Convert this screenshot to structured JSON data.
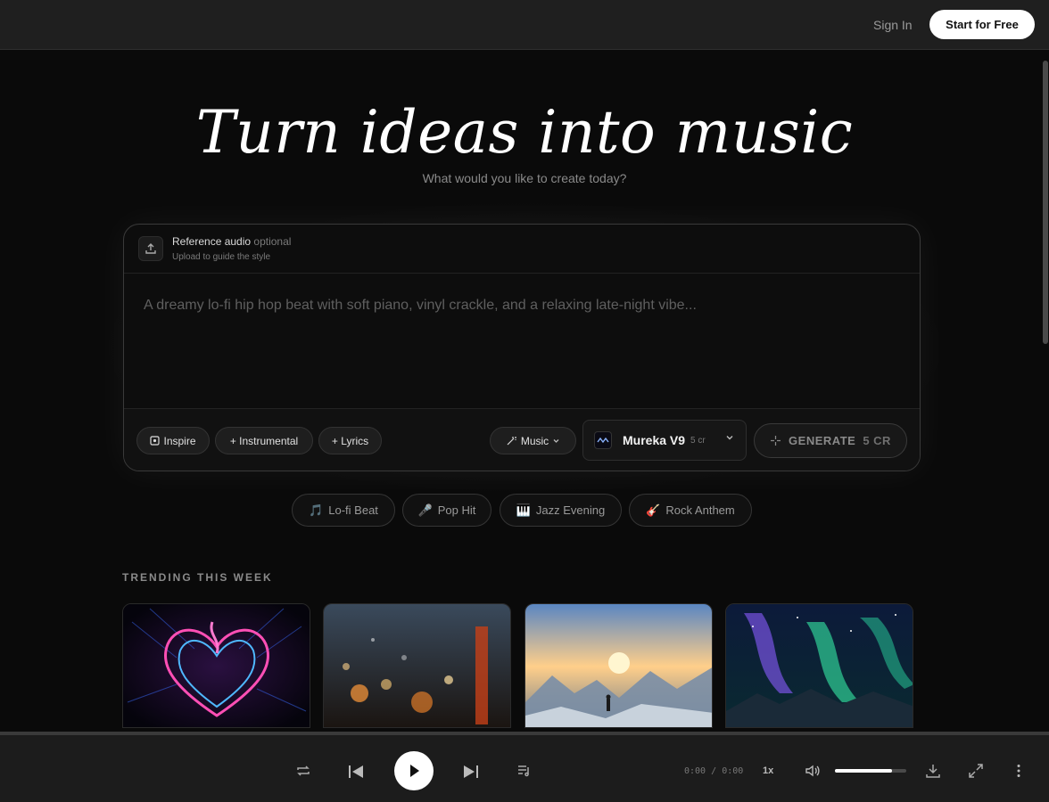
{
  "header": {
    "sign_in": "Sign In",
    "start_free": "Start for Free"
  },
  "hero": {
    "title": "Turn ideas into music",
    "subtitle": "What would you like to create today?"
  },
  "composer": {
    "reference": {
      "title": "Reference audio",
      "optional": "optional",
      "hint": "Upload to guide the style"
    },
    "prompt_placeholder": "A dreamy lo-fi hip hop beat with soft piano, vinyl crackle, and a relaxing late-night vibe...",
    "chips": {
      "inspire": "Inspire",
      "instrumental": "+ Instrumental",
      "lyrics": "+ Lyrics"
    },
    "mode": "Music",
    "model": {
      "name": "Mureka V9",
      "credits": "5 cr"
    },
    "generate": {
      "label": "GENERATE",
      "credits": "5 CR"
    }
  },
  "presets": [
    {
      "icon": "🎵",
      "label": "Lo-fi Beat"
    },
    {
      "icon": "🎤",
      "label": "Pop Hit"
    },
    {
      "icon": "🎹",
      "label": "Jazz Evening"
    },
    {
      "icon": "🎸",
      "label": "Rock Anthem"
    }
  ],
  "trending": {
    "label": "TRENDING THIS WEEK"
  },
  "player": {
    "time_current": "0:00",
    "time_sep": "/",
    "time_total": "0:00",
    "speed": "1x",
    "volume": 0.8
  },
  "colors": {
    "accent": "#ffffff",
    "background": "#0a0a0a",
    "surface": "#1c1c1c"
  }
}
